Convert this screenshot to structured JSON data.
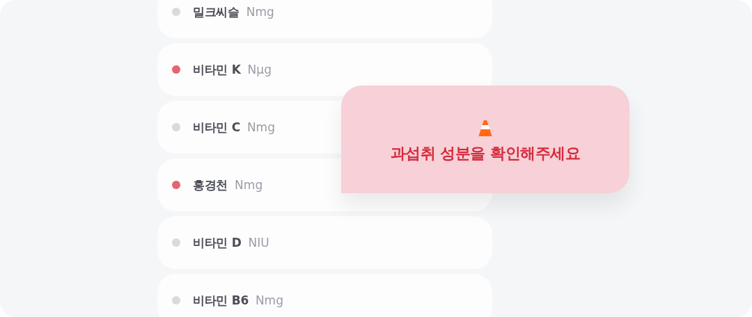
{
  "ingredients": [
    {
      "name": "밀크씨슬",
      "amount": "Nmg",
      "color": "#d9dade"
    },
    {
      "name": "비타민 K",
      "amount": "Nμg",
      "color": "#e5646e"
    },
    {
      "name": "비타민 C",
      "amount": "Nmg",
      "color": "#d9dade"
    },
    {
      "name": "홍경천",
      "amount": "Nmg",
      "color": "#e5646e"
    },
    {
      "name": "비타민 D",
      "amount": "NIU",
      "color": "#d9dade"
    },
    {
      "name": "비타민 B6",
      "amount": "Nmg",
      "color": "#d9dade"
    }
  ],
  "alert": {
    "message": "과섭취 성분을 확인해주세요"
  }
}
